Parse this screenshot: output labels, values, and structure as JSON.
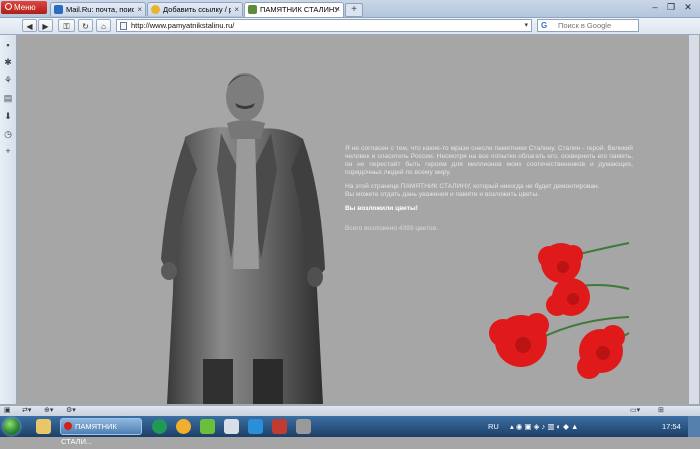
{
  "browser": {
    "menu_label": "Меню",
    "tabs": [
      {
        "title": "Mail.Ru: почта, поиск ...",
        "icon": "mailru-icon",
        "icon_color": "#2a6cc0",
        "active": false
      },
      {
        "title": "Добавить ссылку / pik...",
        "icon": "smiley-icon",
        "icon_color": "#e9b52c",
        "active": false
      },
      {
        "title": "ПАМЯТНИК СТАЛИНУ",
        "icon": "page-icon",
        "icon_color": "#5a8e3a",
        "active": true
      }
    ],
    "new_tab_label": "+",
    "address": "http://www.pamyatnikstalinu.ru/",
    "search_placeholder": "Поиск в Google"
  },
  "page": {
    "paragraph1": "Я не согласен с тем, что какие-то мрази снесли памятники Сталину. Сталин - герой. Великий человек и спаситель России. Несмотря на все попытки облагать его, осквернить его память, он не перестаёт быть героем для миллионов моих соотечественников и думающих, порядочных людей по всему миру.",
    "paragraph2": "На этой странице ПАМЯТНИК СТАЛИНУ, который никогда не будет демонтирован.",
    "paragraph3": "Вы можете отдать дань уважения и памяти и возложить цветы.",
    "cta": "Вы возложили цветы!",
    "total": "Всего возложено 4399 цветов."
  },
  "taskbar": {
    "opera_label": "ПАМЯТНИК СТАЛИ...",
    "language": "RU",
    "clock": "17:54"
  },
  "colors": {
    "page_bg": "#a6a6a6",
    "opera_red": "#d2211a",
    "carnation_red": "#e01a1a"
  }
}
